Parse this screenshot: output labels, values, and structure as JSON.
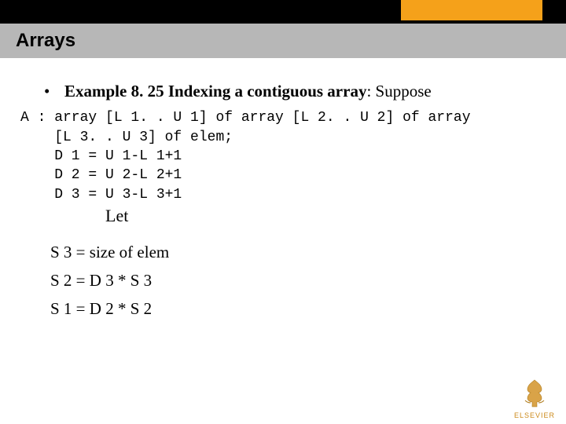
{
  "header": {
    "title": "Arrays"
  },
  "bullet": {
    "heading_bold": "Example 8. 25 Indexing a contiguous array",
    "heading_tail": ": Suppose"
  },
  "code": {
    "l1": "A : array [L 1. . U 1] of array [L 2. . U 2] of array",
    "l2": "    [L 3. . U 3] of elem;",
    "l3": "    D 1 = U 1-L 1+1",
    "l4": "    D 2 = U 2-L 2+1",
    "l5": "    D 3 = U 3-L 3+1",
    "let_word": "Let"
  },
  "serif": {
    "s3": "S 3 = size of elem",
    "s2": "S 2 = D 3 * S 3",
    "s1": "S 1 = D 2 * S 2"
  },
  "logo": {
    "text": "ELSEVIER"
  }
}
